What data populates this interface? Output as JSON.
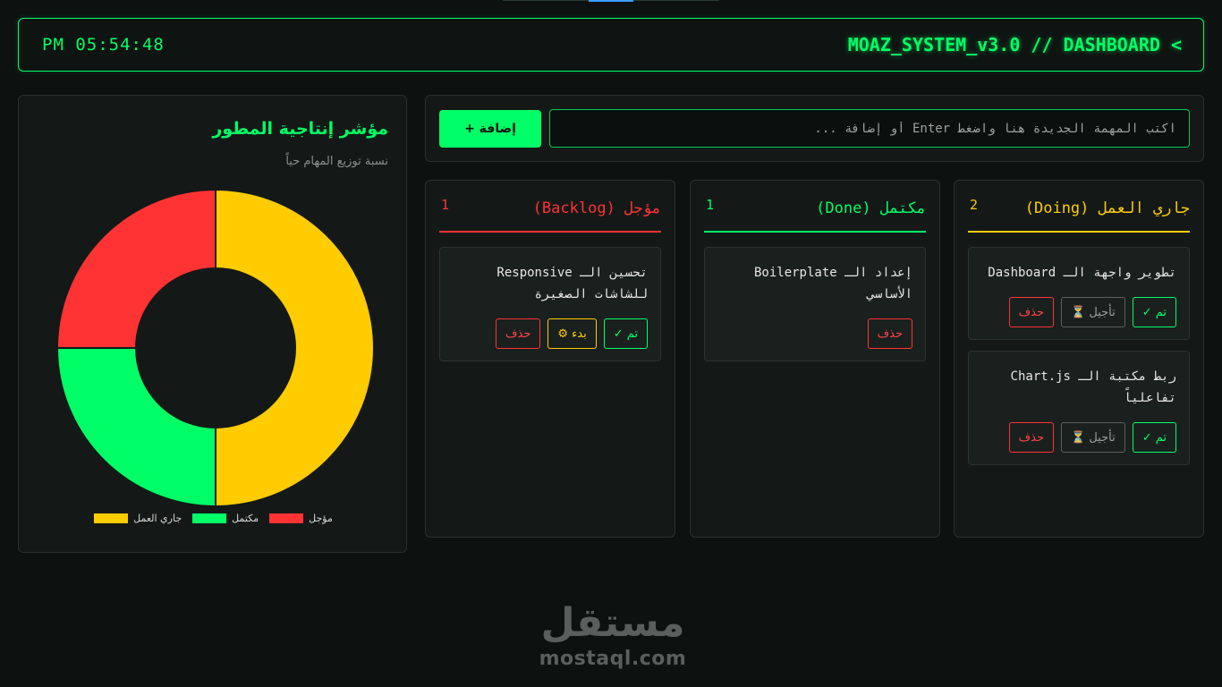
{
  "header": {
    "title": "MOAZ_SYSTEM_v3.0 // DASHBOARD <",
    "clock": "PM 05:54:48"
  },
  "chart_panel": {
    "title": "مؤشر إنتاجية المطور",
    "subtitle": "نسبة توزيع المهام حياً"
  },
  "chart_data": {
    "type": "pie",
    "categories": [
      "جاري العمل",
      "مكتمل",
      "مؤجل"
    ],
    "values": [
      2,
      1,
      1
    ],
    "colors": [
      "#ffcc00",
      "#00ff66",
      "#ff3333"
    ],
    "legend_placement": "bottom",
    "donut": true
  },
  "input": {
    "placeholder": "اكتب المهمة الجديدة هنا واضغط Enter أو إضافة ...",
    "value": "",
    "add_label": "إضافة +"
  },
  "columns": [
    {
      "name": "جاري العمل (Doing)",
      "count": "2",
      "color": "#ffcc00",
      "cards": [
        {
          "text": "تطوير واجهة الـ Dashboard",
          "buttons": [
            {
              "label": "تم ✓",
              "kind": "done"
            },
            {
              "label": "تأجيل ⏳",
              "kind": "delay"
            },
            {
              "label": "حذف",
              "kind": "del"
            }
          ]
        },
        {
          "text": "ربط مكتبة الـ Chart.js تفاعلياً",
          "buttons": [
            {
              "label": "تم ✓",
              "kind": "done"
            },
            {
              "label": "تأجيل ⏳",
              "kind": "delay"
            },
            {
              "label": "حذف",
              "kind": "del"
            }
          ]
        }
      ]
    },
    {
      "name": "مكتمل (Done)",
      "count": "1",
      "color": "#00ff66",
      "cards": [
        {
          "text": "إعداد الـ Boilerplate الأساسي",
          "buttons": [
            {
              "label": "حذف",
              "kind": "del"
            }
          ]
        }
      ]
    },
    {
      "name": "مؤجل (Backlog)",
      "count": "1",
      "color": "#ff3333",
      "cards": [
        {
          "text": "تحسين الـ Responsive للشاشات الصغيرة",
          "buttons": [
            {
              "label": "تم ✓",
              "kind": "done"
            },
            {
              "label": "بدء ⚙",
              "kind": "start"
            },
            {
              "label": "حذف",
              "kind": "del"
            }
          ]
        }
      ]
    }
  ],
  "watermark": {
    "arabic": "مستقل",
    "latin": "mostaql.com"
  }
}
